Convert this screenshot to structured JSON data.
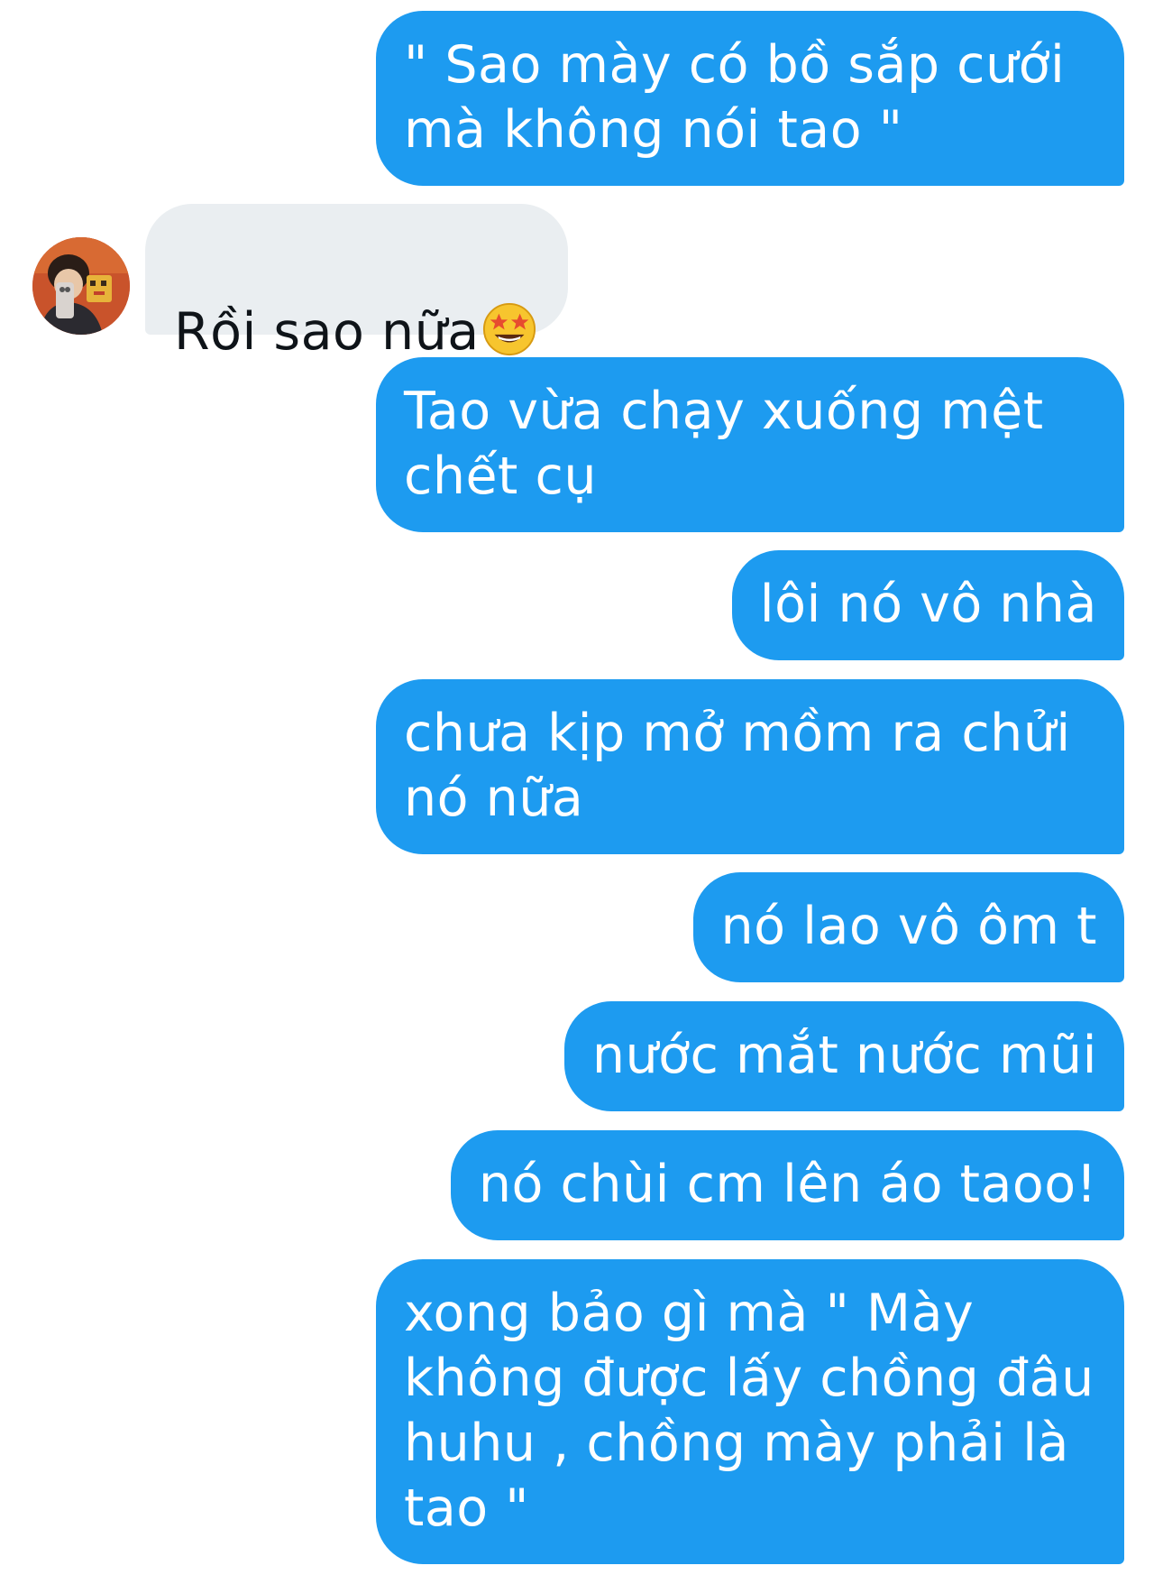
{
  "conversation": {
    "messages": [
      {
        "direction": "outgoing",
        "text": "\" Sao mày có bồ sắp cưới\nmà không nói tao \""
      },
      {
        "direction": "incoming",
        "text": "Rồi sao nữa",
        "emoji": "star-struck-emoji"
      },
      {
        "direction": "outgoing",
        "text": "Tao vừa chạy xuống mệt\nchết cụ"
      },
      {
        "direction": "outgoing",
        "text": "lôi nó vô nhà"
      },
      {
        "direction": "outgoing",
        "text": "chưa kịp mở mồm ra chửi\nnó nữa"
      },
      {
        "direction": "outgoing",
        "text": "nó lao vô ôm t"
      },
      {
        "direction": "outgoing",
        "text": "nước mắt nước mũi"
      },
      {
        "direction": "outgoing",
        "text": "nó chùi cm lên áo taoo!"
      },
      {
        "direction": "outgoing",
        "text": "xong bảo gì mà \" Mày\nkhông được lấy chồng đâu\nhuhu , chồng mày phải là\ntao \""
      }
    ]
  },
  "colors": {
    "outgoing_bubble": "#1d9bf0",
    "incoming_bubble": "#eaeef1",
    "outgoing_text": "#ffffff",
    "incoming_text": "#0f1419",
    "background": "#ffffff"
  }
}
